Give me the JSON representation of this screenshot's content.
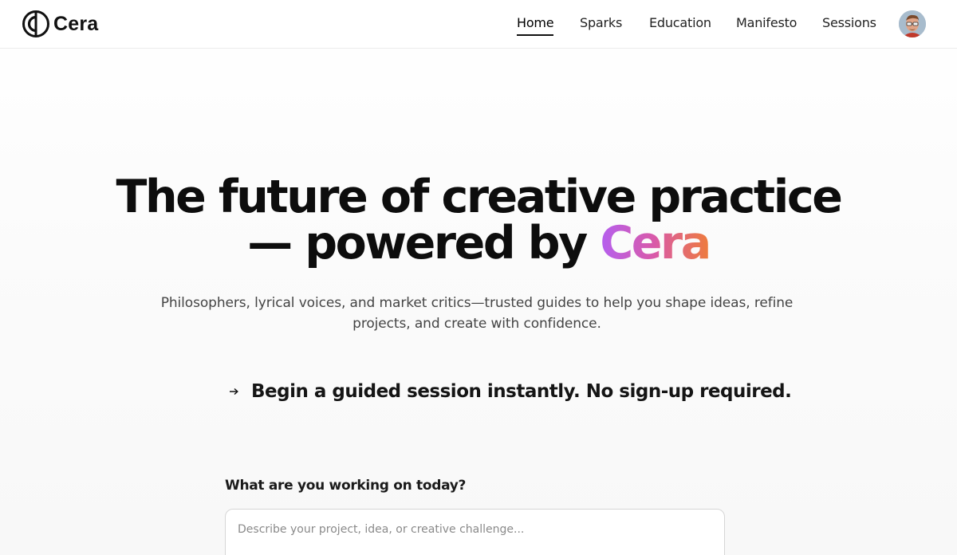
{
  "brand": {
    "name": "Cera",
    "logo_icon": "cera-logo-icon"
  },
  "nav": {
    "items": [
      {
        "label": "Home",
        "active": true
      },
      {
        "label": "Sparks",
        "active": false
      },
      {
        "label": "Education",
        "active": false
      },
      {
        "label": "Manifesto",
        "active": false
      },
      {
        "label": "Sessions",
        "active": false
      }
    ],
    "avatar_icon": "user-avatar"
  },
  "hero": {
    "title_line1": "The future of creative practice",
    "title_line2_prefix": "— powered by ",
    "title_line2_highlight": "Cera",
    "subtitle": "Philosophers, lyrical voices, and market critics—trusted guides to help you shape ideas, refine projects, and create with confidence.",
    "highlight_gradient": [
      "#b45ff0",
      "#d95aa8",
      "#ee7c3b"
    ]
  },
  "cta": {
    "icon": "arrow-right-icon",
    "text": "Begin a guided session instantly. No sign-up required."
  },
  "form": {
    "label": "What are you working on today?",
    "placeholder": "Describe your project, idea, or creative challenge...",
    "value": ""
  }
}
